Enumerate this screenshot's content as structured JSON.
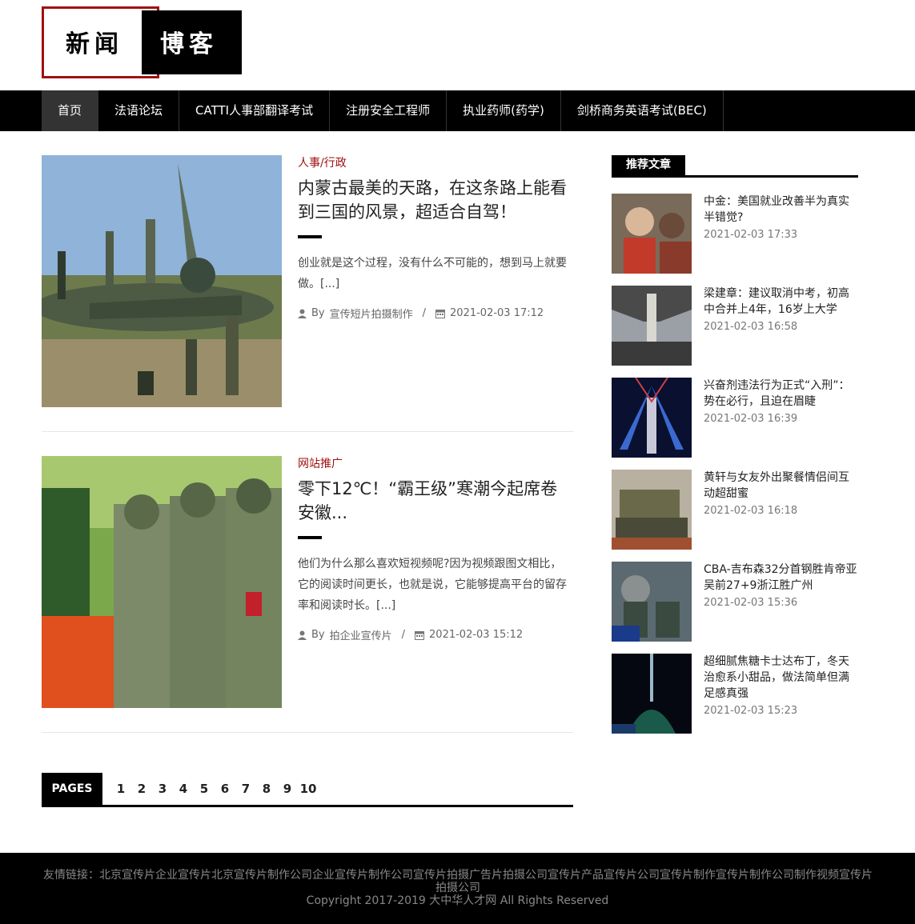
{
  "logo": {
    "left_text": "新闻",
    "right_text": "博客"
  },
  "nav": {
    "items": [
      {
        "label": "首页",
        "active": true
      },
      {
        "label": "法语论坛"
      },
      {
        "label": "CATTI人事部翻译考试"
      },
      {
        "label": "注册安全工程师"
      },
      {
        "label": "执业药师(药学)"
      },
      {
        "label": "剑桥商务英语考试(BEC)"
      }
    ]
  },
  "posts": [
    {
      "category": "人事/行政",
      "title": "内蒙古最美的天路，在这条路上能看到三国的风景，超适合自驾！",
      "excerpt": "创业就是这个过程，没有什么不可能的，想到马上就要做。[...]",
      "by": "By",
      "author": "宣传短片拍摄制作",
      "date": "2021-02-03 17:12"
    },
    {
      "category": "网站推广",
      "title": "零下12℃！“霸王级”寒潮今起席卷安徽...",
      "excerpt": "他们为什么那么喜欢短视频呢?因为视频跟图文相比，它的阅读时间更长，也就是说，它能够提高平台的留存率和阅读时长。[...]",
      "by": "By",
      "author": "拍企业宣传片",
      "date": "2021-02-03 15:12"
    }
  ],
  "pagination": {
    "label": "PAGES",
    "pages": [
      "1",
      "2",
      "3",
      "4",
      "5",
      "6",
      "7",
      "8",
      "9",
      "10"
    ]
  },
  "sidebar": {
    "heading": "推荐文章",
    "items": [
      {
        "title": "中金：美国就业改善半为真实半错觉?",
        "date": "2021-02-03 17:33"
      },
      {
        "title": "梁建章：建议取消中考，初高中合并上4年，16岁上大学",
        "date": "2021-02-03 16:58"
      },
      {
        "title": "兴奋剂违法行为正式“入刑”：势在必行，且迫在眉睫",
        "date": "2021-02-03 16:39"
      },
      {
        "title": "黄轩与女友外出聚餐情侣间互动超甜蜜",
        "date": "2021-02-03 16:18"
      },
      {
        "title": "CBA-吉布森32分首钢胜肯帝亚吴前27+9浙江胜广州",
        "date": "2021-02-03 15:36"
      },
      {
        "title": "超细腻焦糖卡士达布丁，冬天治愈系小甜品，做法简单但满足感真强",
        "date": "2021-02-03 15:23"
      }
    ]
  },
  "footer": {
    "links": "友情链接：北京宣传片企业宣传片北京宣传片制作公司企业宣传片制作公司宣传片拍摄广告片拍摄公司宣传片产品宣传片公司宣传片制作宣传片制作公司制作视频宣传片拍摄公司",
    "copyright": "Copyright 2017-2019 大中华人才网 All Rights Reserved"
  }
}
